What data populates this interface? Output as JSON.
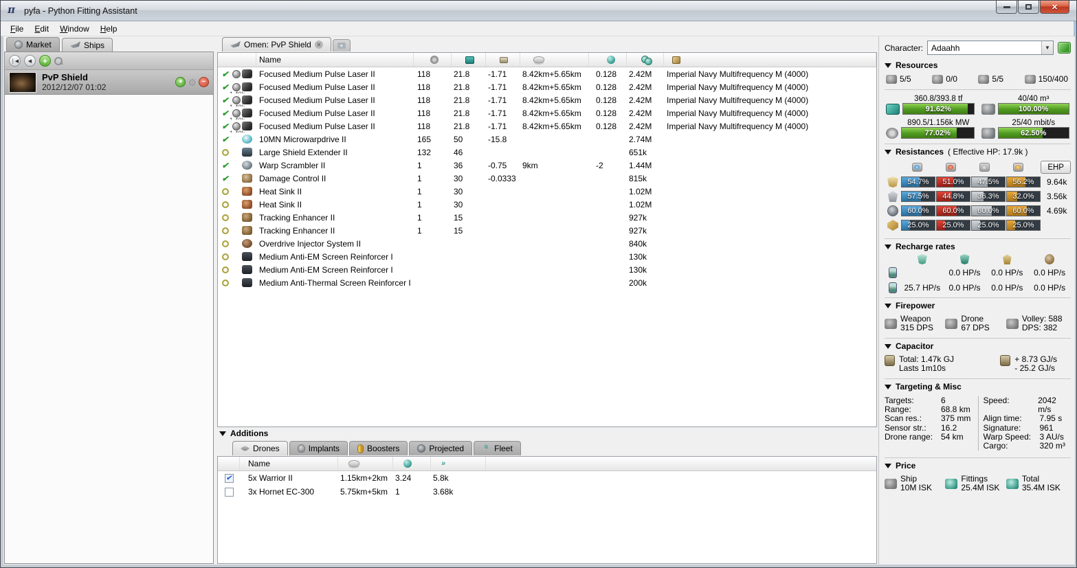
{
  "window": {
    "title": "pyfa - Python Fitting Assistant"
  },
  "menu": [
    {
      "first": "F",
      "rest": "ile"
    },
    {
      "first": "E",
      "rest": "dit"
    },
    {
      "first": "W",
      "rest": "indow"
    },
    {
      "first": "H",
      "rest": "elp"
    }
  ],
  "left_panel": {
    "tabs": [
      {
        "label": "Market"
      },
      {
        "label": "Ships"
      }
    ],
    "fit": {
      "name": "PvP Shield",
      "date": "2012/12/07 01:02"
    }
  },
  "fitting": {
    "tab_label": "Omen: PvP Shield",
    "columns": {
      "name": "Name"
    },
    "rows": [
      {
        "state": "active",
        "charge": "has-charge",
        "icon": "pulse-laser",
        "name": "Focused Medium Pulse Laser II",
        "pg": "118",
        "cpu": "21.8",
        "cap": "-1.71",
        "range": "8.42km+5.65km",
        "tracking": "0.128",
        "price": "2.42M",
        "ammo": "Imperial Navy Multifrequency M (4000)",
        "sub": ""
      },
      {
        "state": "active",
        "charge": "has-charge",
        "icon": "pulse-laser",
        "name": "Focused Medium Pulse Laser II",
        "pg": "118",
        "cpu": "21.8",
        "cap": "-1.71",
        "range": "8.42km+5.65km",
        "tracking": "0.128",
        "price": "2.42M",
        "ammo": "Imperial Navy Multifrequency M (4000)",
        "sub": "1.40k"
      },
      {
        "state": "active",
        "charge": "has-charge",
        "icon": "pulse-laser",
        "name": "Focused Medium Pulse Laser II",
        "pg": "118",
        "cpu": "21.8",
        "cap": "-1.71",
        "range": "8.42km+5.65km",
        "tracking": "0.128",
        "price": "2.42M",
        "ammo": "Imperial Navy Multifrequency M (4000)",
        "sub": "1.40k"
      },
      {
        "state": "active",
        "charge": "has-charge",
        "icon": "pulse-laser",
        "name": "Focused Medium Pulse Laser II",
        "pg": "118",
        "cpu": "21.8",
        "cap": "-1.71",
        "range": "8.42km+5.65km",
        "tracking": "0.128",
        "price": "2.42M",
        "ammo": "Imperial Navy Multifrequency M (4000)",
        "sub": "1.40k"
      },
      {
        "state": "active",
        "charge": "has-charge",
        "icon": "pulse-laser",
        "name": "Focused Medium Pulse Laser II",
        "pg": "118",
        "cpu": "21.8",
        "cap": "-1.71",
        "range": "8.42km+5.65km",
        "tracking": "0.128",
        "price": "2.42M",
        "ammo": "Imperial Navy Multifrequency M (4000)",
        "sub": "1.40k"
      },
      {
        "state": "active",
        "charge": "",
        "icon": "mwd",
        "name": "10MN Microwarpdrive II",
        "pg": "165",
        "cpu": "50",
        "cap": "-15.8",
        "range": "",
        "tracking": "",
        "price": "2.74M",
        "ammo": "",
        "sub": ""
      },
      {
        "state": "online",
        "charge": "",
        "icon": "shield-extender",
        "name": "Large Shield Extender II",
        "pg": "132",
        "cpu": "46",
        "cap": "",
        "range": "",
        "tracking": "",
        "price": "651k",
        "ammo": "",
        "sub": ""
      },
      {
        "state": "active",
        "charge": "",
        "icon": "warp-scrambler",
        "name": "Warp Scrambler II",
        "pg": "1",
        "cpu": "36",
        "cap": "-0.75",
        "range": "9km",
        "tracking": "-2",
        "price": "1.44M",
        "ammo": "",
        "sub": ""
      },
      {
        "state": "active",
        "charge": "",
        "icon": "damage-control",
        "name": "Damage Control II",
        "pg": "1",
        "cpu": "30",
        "cap": "-0.0333",
        "range": "",
        "tracking": "",
        "price": "815k",
        "ammo": "",
        "sub": ""
      },
      {
        "state": "online",
        "charge": "",
        "icon": "heat-sink",
        "name": "Heat Sink II",
        "pg": "1",
        "cpu": "30",
        "cap": "",
        "range": "",
        "tracking": "",
        "price": "1.02M",
        "ammo": "",
        "sub": ""
      },
      {
        "state": "online",
        "charge": "",
        "icon": "heat-sink",
        "name": "Heat Sink II",
        "pg": "1",
        "cpu": "30",
        "cap": "",
        "range": "",
        "tracking": "",
        "price": "1.02M",
        "ammo": "",
        "sub": ""
      },
      {
        "state": "online",
        "charge": "",
        "icon": "tracking-enhancer",
        "name": "Tracking Enhancer II",
        "pg": "1",
        "cpu": "15",
        "cap": "",
        "range": "",
        "tracking": "",
        "price": "927k",
        "ammo": "",
        "sub": ""
      },
      {
        "state": "online",
        "charge": "",
        "icon": "tracking-enhancer",
        "name": "Tracking Enhancer II",
        "pg": "1",
        "cpu": "15",
        "cap": "",
        "range": "",
        "tracking": "",
        "price": "927k",
        "ammo": "",
        "sub": ""
      },
      {
        "state": "online",
        "charge": "",
        "icon": "overdrive",
        "name": "Overdrive Injector System II",
        "pg": "",
        "cpu": "",
        "cap": "",
        "range": "",
        "tracking": "",
        "price": "840k",
        "ammo": "",
        "sub": ""
      },
      {
        "state": "online",
        "charge": "",
        "icon": "rig-em",
        "name": "Medium Anti-EM Screen Reinforcer I",
        "pg": "",
        "cpu": "",
        "cap": "",
        "range": "",
        "tracking": "",
        "price": "130k",
        "ammo": "",
        "sub": ""
      },
      {
        "state": "online",
        "charge": "",
        "icon": "rig-em",
        "name": "Medium Anti-EM Screen Reinforcer I",
        "pg": "",
        "cpu": "",
        "cap": "",
        "range": "",
        "tracking": "",
        "price": "130k",
        "ammo": "",
        "sub": ""
      },
      {
        "state": "online",
        "charge": "",
        "icon": "rig-thermal",
        "name": "Medium Anti-Thermal Screen Reinforcer I",
        "pg": "",
        "cpu": "",
        "cap": "",
        "range": "",
        "tracking": "",
        "price": "200k",
        "ammo": "",
        "sub": ""
      }
    ]
  },
  "additions": {
    "header": "Additions",
    "tabs": [
      {
        "label": "Drones"
      },
      {
        "label": "Implants"
      },
      {
        "label": "Boosters"
      },
      {
        "label": "Projected"
      },
      {
        "label": "Fleet"
      }
    ],
    "columns": {
      "name": "Name"
    },
    "drones": [
      {
        "checked": "checked",
        "name": "5x Warrior II",
        "range": "1.15km+2km",
        "tracking": "3.24",
        "speed": "5.8k"
      },
      {
        "checked": "",
        "name": "3x Hornet EC-300",
        "range": "5.75km+5km",
        "tracking": "1",
        "speed": "3.68k"
      }
    ]
  },
  "panel": {
    "character_label": "Character:",
    "character_value": "Adaahh",
    "headers": {
      "resources": "Resources",
      "resistances": "Resistances",
      "effective_hp": "( Effective HP: 17.9k )",
      "recharge": "Recharge rates",
      "firepower": "Firepower",
      "capacitor": "Capacitor",
      "targeting": "Targeting & Misc",
      "price": "Price"
    },
    "resources": {
      "slots": [
        {
          "value": "5/5"
        },
        {
          "value": "0/0"
        },
        {
          "value": "5/5"
        },
        {
          "value": "150/400"
        }
      ],
      "cpu": {
        "label": "360.8/393.8 tf",
        "pct": 91.62,
        "text": "91.62%"
      },
      "dronebay": {
        "label": "40/40 m³",
        "pct": 100,
        "text": "100.00%"
      },
      "powergrid": {
        "label": "890.5/1.156k MW",
        "pct": 77.02,
        "text": "77.02%"
      },
      "bandwidth": {
        "label": "25/40 mbit/s",
        "pct": 62.5,
        "text": "62.50%"
      }
    },
    "resistances": {
      "ehp_button": "EHP",
      "rows": [
        {
          "icon": "shield",
          "em": {
            "pct": 54.7,
            "label": "54.7%"
          },
          "th": {
            "pct": 51.0,
            "label": "51.0%"
          },
          "ki": {
            "pct": 47.5,
            "label": "47.5%"
          },
          "ex": {
            "pct": 56.2,
            "label": "56.2%"
          },
          "ehp": "9.64k"
        },
        {
          "icon": "armor",
          "em": {
            "pct": 57.5,
            "label": "57.5%"
          },
          "th": {
            "pct": 44.8,
            "label": "44.8%"
          },
          "ki": {
            "pct": 36.3,
            "label": "36.3%"
          },
          "ex": {
            "pct": 32.0,
            "label": "32.0%"
          },
          "ehp": "3.56k"
        },
        {
          "icon": "hull",
          "em": {
            "pct": 60.0,
            "label": "60.0%"
          },
          "th": {
            "pct": 60.0,
            "label": "60.0%"
          },
          "ki": {
            "pct": 60.0,
            "label": "60.0%"
          },
          "ex": {
            "pct": 60.0,
            "label": "60.0%"
          },
          "ehp": "4.69k"
        },
        {
          "icon": "damage",
          "em": {
            "pct": 25.0,
            "label": "25.0%"
          },
          "th": {
            "pct": 25.0,
            "label": "25.0%"
          },
          "ki": {
            "pct": 25.0,
            "label": "25.0%"
          },
          "ex": {
            "pct": 25.0,
            "label": "25.0%"
          },
          "ehp": ""
        }
      ]
    },
    "recharge": {
      "rows": [
        {
          "icon": "reinforced",
          "c0": "",
          "c1": "0.0 HP/s",
          "c2": "0.0 HP/s",
          "c3": "0.0 HP/s"
        },
        {
          "icon": "sustained",
          "c0": "25.7 HP/s",
          "c1": "0.0 HP/s",
          "c2": "0.0 HP/s",
          "c3": "0.0 HP/s"
        }
      ]
    },
    "firepower": [
      {
        "label": "Weapon",
        "value": "315 DPS"
      },
      {
        "label": "Drone",
        "value": "67 DPS"
      },
      {
        "label": "Volley: 588",
        "value": "DPS: 382"
      }
    ],
    "capacitor": {
      "total": "Total: 1.47k GJ",
      "lasts": "Lasts 1m10s",
      "peak": "+ 8.73 GJ/s",
      "drain": "- 25.2 GJ/s"
    },
    "targeting": {
      "left": [
        {
          "label": "Targets:",
          "value": "6"
        },
        {
          "label": "Range:",
          "value": "68.8 km"
        },
        {
          "label": "Scan res.:",
          "value": "375 mm"
        },
        {
          "label": "Sensor str.:",
          "value": "16.2"
        },
        {
          "label": "Drone range:",
          "value": "54 km"
        }
      ],
      "right": [
        {
          "label": "Speed:",
          "value": "2042 m/s"
        },
        {
          "label": "Align time:",
          "value": "7.95 s"
        },
        {
          "label": "Signature:",
          "value": "961"
        },
        {
          "label": "Warp Speed:",
          "value": "3 AU/s"
        },
        {
          "label": "Cargo:",
          "value": "320 m³"
        }
      ]
    },
    "price": [
      {
        "label": "Ship",
        "value": "10M ISK"
      },
      {
        "label": "Fittings",
        "value": "25.4M ISK"
      },
      {
        "label": "Total",
        "value": "35.4M ISK"
      }
    ]
  }
}
